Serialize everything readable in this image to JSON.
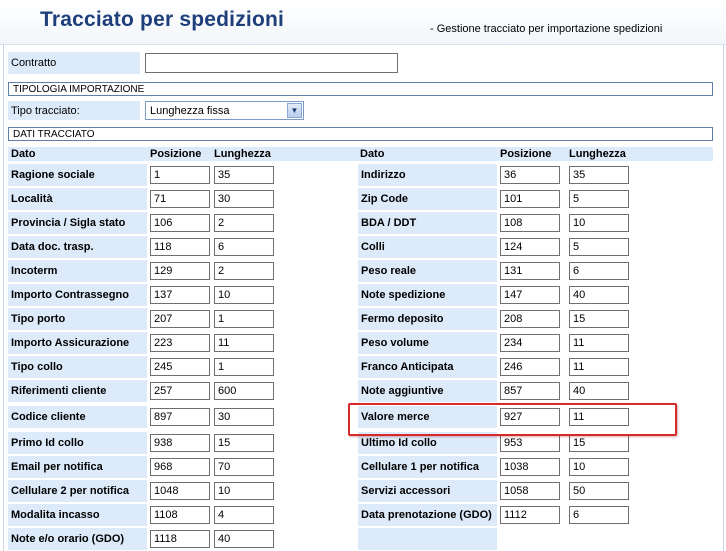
{
  "header": {
    "title": "Tracciato per spedizioni",
    "subtitle": "- Gestione tracciato per importazione spedizioni"
  },
  "contratto": {
    "label": "Contratto",
    "value": ""
  },
  "tipologia": {
    "section_title": "TIPOLOGIA IMPORTAZIONE",
    "label": "Tipo tracciato:",
    "selected": "Lunghezza fissa"
  },
  "dati": {
    "section_title": "DATI TRACCIATO",
    "headers": {
      "dato": "Dato",
      "posizione": "Posizione",
      "lunghezza": "Lunghezza"
    },
    "left": [
      {
        "dato": "Ragione sociale",
        "posizione": "1",
        "lunghezza": "35"
      },
      {
        "dato": "Località",
        "posizione": "71",
        "lunghezza": "30"
      },
      {
        "dato": "Provincia / Sigla stato",
        "posizione": "106",
        "lunghezza": "2"
      },
      {
        "dato": "Data doc. trasp.",
        "posizione": "118",
        "lunghezza": "6"
      },
      {
        "dato": "Incoterm",
        "posizione": "129",
        "lunghezza": "2"
      },
      {
        "dato": "Importo Contrassegno",
        "posizione": "137",
        "lunghezza": "10"
      },
      {
        "dato": "Tipo porto",
        "posizione": "207",
        "lunghezza": "1"
      },
      {
        "dato": "Importo Assicurazione",
        "posizione": "223",
        "lunghezza": "11"
      },
      {
        "dato": "Tipo collo",
        "posizione": "245",
        "lunghezza": "1"
      },
      {
        "dato": "Riferimenti cliente",
        "posizione": "257",
        "lunghezza": "600"
      },
      {
        "dato": "Codice cliente",
        "posizione": "897",
        "lunghezza": "30"
      },
      {
        "dato": "Primo Id collo",
        "posizione": "938",
        "lunghezza": "15"
      },
      {
        "dato": "Email per notifica",
        "posizione": "968",
        "lunghezza": "70"
      },
      {
        "dato": "Cellulare 2 per notifica",
        "posizione": "1048",
        "lunghezza": "10"
      },
      {
        "dato": "Modalita incasso",
        "posizione": "1108",
        "lunghezza": "4"
      },
      {
        "dato": "Note e/o orario (GDO)",
        "posizione": "1118",
        "lunghezza": "40"
      }
    ],
    "right": [
      {
        "dato": "Indirizzo",
        "posizione": "36",
        "lunghezza": "35"
      },
      {
        "dato": "Zip Code",
        "posizione": "101",
        "lunghezza": "5"
      },
      {
        "dato": "BDA / DDT",
        "posizione": "108",
        "lunghezza": "10"
      },
      {
        "dato": "Colli",
        "posizione": "124",
        "lunghezza": "5"
      },
      {
        "dato": "Peso reale",
        "posizione": "131",
        "lunghezza": "6"
      },
      {
        "dato": "Note spedizione",
        "posizione": "147",
        "lunghezza": "40"
      },
      {
        "dato": "Fermo deposito",
        "posizione": "208",
        "lunghezza": "15"
      },
      {
        "dato": "Peso volume",
        "posizione": "234",
        "lunghezza": "11"
      },
      {
        "dato": "Franco Anticipata",
        "posizione": "246",
        "lunghezza": "11"
      },
      {
        "dato": "Note aggiuntive",
        "posizione": "857",
        "lunghezza": "40"
      },
      {
        "dato": "Valore merce",
        "posizione": "927",
        "lunghezza": "11"
      },
      {
        "dato": "Ultimo Id collo",
        "posizione": "953",
        "lunghezza": "15"
      },
      {
        "dato": "Cellulare 1 per notifica",
        "posizione": "1038",
        "lunghezza": "10"
      },
      {
        "dato": "Servizi accessori",
        "posizione": "1058",
        "lunghezza": "50"
      },
      {
        "dato": "Data prenotazione (GDO)",
        "posizione": "1112",
        "lunghezza": "6"
      }
    ]
  },
  "colors": {
    "label_bg": "#ddeafa",
    "title": "#1f3f7a",
    "highlight": "#d62a2a"
  }
}
